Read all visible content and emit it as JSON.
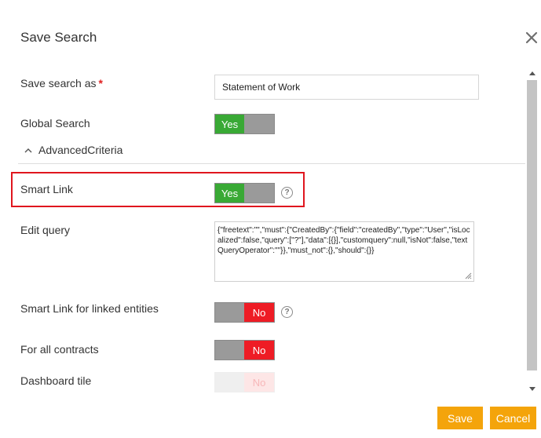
{
  "dialog": {
    "title": "Save Search",
    "close_icon": "close-icon"
  },
  "form": {
    "save_search_as": {
      "label": "Save search as",
      "required_mark": "*",
      "value": "Statement of Work"
    },
    "global_search": {
      "label": "Global Search",
      "state": "Yes"
    },
    "advanced_criteria": {
      "label": "AdvancedCriteria",
      "icon": "chevron-up-icon"
    },
    "smart_link": {
      "label": "Smart Link",
      "state": "Yes",
      "help": "?"
    },
    "edit_query": {
      "label": "Edit query",
      "value": "{\"freetext\":\"\",\"must\":{\"CreatedBy\":{\"field\":\"createdBy\",\"type\":\"User\",\"isLocalized\":false,\"query\":[\"?\"],\"data\":[{}],\"customquery\":null,\"isNot\":false,\"textQueryOperator\":\"\"}},\"must_not\":{},\"should\":{}}"
    },
    "smart_link_linked": {
      "label": "Smart Link for linked entities",
      "state": "No",
      "help": "?"
    },
    "all_contracts": {
      "label": "For all contracts",
      "state": "No"
    },
    "dashboard_tile": {
      "label": "Dashboard tile",
      "state": "No"
    }
  },
  "footer": {
    "save_label": "Save",
    "cancel_label": "Cancel"
  },
  "colors": {
    "yes_green": "#39a935",
    "no_red": "#ee1c25",
    "accent_orange": "#f4a40b",
    "highlight_red": "#e0161e"
  }
}
